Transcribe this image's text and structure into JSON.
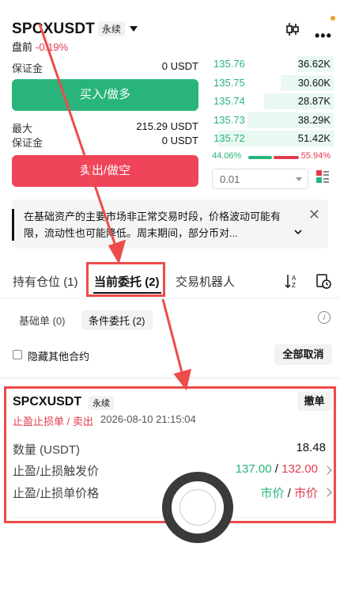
{
  "header": {
    "symbol": "SPCXUSDT",
    "perp_badge": "永续",
    "session_label": "盘前",
    "change_pct": "-0.19%"
  },
  "trade_panel": {
    "margin_label": "保证金",
    "margin_value": "0 USDT",
    "buy_label": "买入/做多",
    "max_label": "最大",
    "max_value": "215.29 USDT",
    "margin2_label": "保证金",
    "margin2_value": "0 USDT",
    "sell_label": "卖出/做空"
  },
  "orderbook": {
    "rows": [
      {
        "price": "135.76",
        "qty": "36.62K",
        "depth": 0.28
      },
      {
        "price": "135.75",
        "qty": "30.60K",
        "depth": 0.42
      },
      {
        "price": "135.74",
        "qty": "28.87K",
        "depth": 0.55
      },
      {
        "price": "135.73",
        "qty": "38.29K",
        "depth": 0.68
      },
      {
        "price": "135.72",
        "qty": "51.42K",
        "depth": 0.92
      }
    ],
    "buy_ratio": "44.06%",
    "sell_ratio": "55.94%",
    "depth_value": "0.01"
  },
  "notice": {
    "text": "在基础资产的主要市场非正常交易时段，价格波动可能有限，流动性也可能降低。周末期间，部分币对..."
  },
  "tabs": {
    "positions": "持有仓位",
    "positions_count": "(1)",
    "open_orders": "当前委托",
    "open_orders_count": "(2)",
    "bots": "交易机器人"
  },
  "subtabs": {
    "basic": "基础单 (0)",
    "conditional": "条件委托 (2)"
  },
  "filter": {
    "hide_label": "隐藏其他合约",
    "cancel_all": "全部取消"
  },
  "order": {
    "symbol": "SPCXUSDT",
    "perp_badge": "永续",
    "revoke": "撤单",
    "type": "止盈止损单 / 卖出",
    "time": "2026-08-10 21:15:04",
    "qty_label": "数量 (USDT)",
    "qty_value": "18.48",
    "trigger_label": "止盈/止损触发价",
    "tp_trigger": "137.00",
    "sl_trigger": "132.00",
    "price_label": "止盈/止损单价格",
    "tp_price": "市价",
    "sl_price": "市价"
  },
  "colors": {
    "buy": "#28b47a",
    "sell": "#f0445a",
    "annotation": "#ee4b4b"
  }
}
